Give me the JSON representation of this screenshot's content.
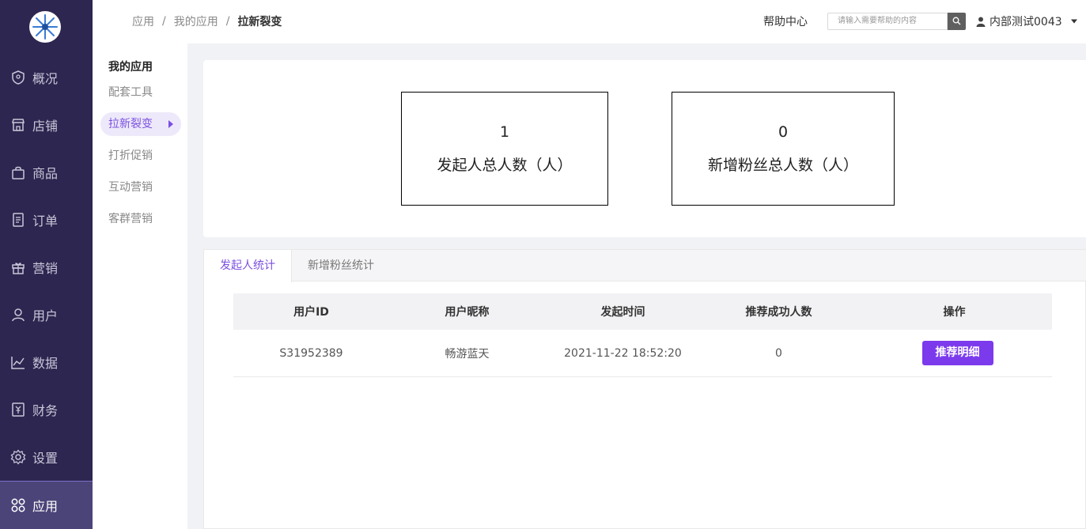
{
  "sidebar": {
    "logo": "logo-icon",
    "items": [
      {
        "label": "概况",
        "icon": "shield-icon"
      },
      {
        "label": "店铺",
        "icon": "store-icon"
      },
      {
        "label": "商品",
        "icon": "bag-icon"
      },
      {
        "label": "订单",
        "icon": "document-icon"
      },
      {
        "label": "营销",
        "icon": "gift-icon"
      },
      {
        "label": "用户",
        "icon": "user-icon"
      },
      {
        "label": "数据",
        "icon": "chart-icon"
      },
      {
        "label": "财务",
        "icon": "yen-icon"
      },
      {
        "label": "设置",
        "icon": "gear-icon"
      },
      {
        "label": "应用",
        "icon": "apps-icon"
      }
    ]
  },
  "header": {
    "breadcrumb": [
      "应用",
      "我的应用",
      "拉新裂变"
    ],
    "separator": "/",
    "help": "帮助中心",
    "search_placeholder": "请输入需要帮助的内容",
    "user": "内部测试0043"
  },
  "subnav": {
    "title": "我的应用",
    "items": [
      "配套工具",
      "拉新裂变",
      "打折促销",
      "互动营销",
      "客群营销"
    ]
  },
  "stats": [
    {
      "value": "1",
      "label": "发起人总人数（人）"
    },
    {
      "value": "0",
      "label": "新增粉丝总人数（人）"
    }
  ],
  "tabs": [
    "发起人统计",
    "新增粉丝统计"
  ],
  "table": {
    "headers": [
      "用户ID",
      "用户昵称",
      "发起时间",
      "推荐成功人数",
      "操作"
    ],
    "rows": [
      {
        "id": "S31952389",
        "nickname": "畅游蓝天",
        "time": "2021-11-22 18:52:20",
        "count": "0",
        "action": "推荐明细"
      }
    ]
  },
  "colors": {
    "sidebar": "#2d2650",
    "accent": "#7c3aed",
    "active_nav": "#4b4478"
  }
}
